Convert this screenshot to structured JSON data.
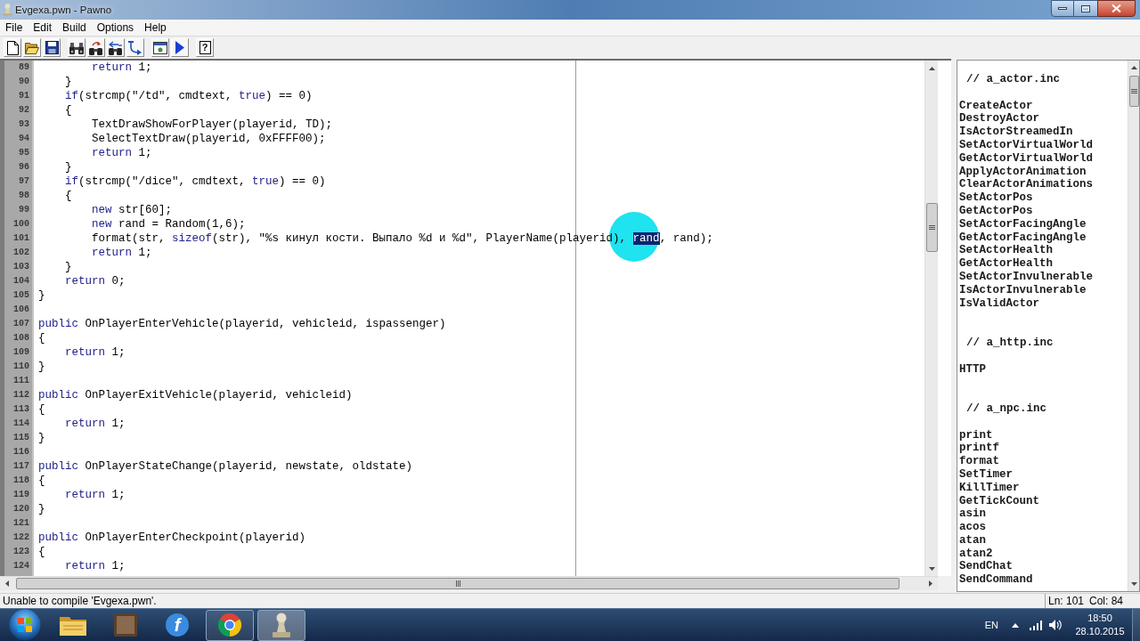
{
  "window": {
    "title": "Evgexa.pwn - Pawno"
  },
  "menu": [
    "File",
    "Edit",
    "Build",
    "Options",
    "Help"
  ],
  "toolbar": [
    [
      {
        "kind": "new"
      },
      {
        "kind": "open"
      },
      {
        "kind": "save"
      }
    ],
    [
      {
        "kind": "find"
      },
      {
        "kind": "find_next"
      },
      {
        "kind": "replace"
      },
      {
        "kind": "goto"
      }
    ],
    [
      {
        "kind": "compile"
      },
      {
        "kind": "run"
      }
    ],
    [
      {
        "kind": "help",
        "glyph": "?"
      }
    ]
  ],
  "editor": {
    "lines": [
      {
        "number": "89",
        "segments": [
          {
            "kind": "keyword",
            "text": "        return"
          },
          {
            "kind": "plain",
            "text": " 1;"
          }
        ]
      },
      {
        "number": "90",
        "segments": [
          {
            "kind": "plain",
            "text": "    }"
          }
        ]
      },
      {
        "number": "91",
        "segments": [
          {
            "kind": "keyword",
            "text": "    if"
          },
          {
            "kind": "plain",
            "text": "(strcmp(\"/td\", cmdtext, "
          },
          {
            "kind": "keyword",
            "text": "true"
          },
          {
            "kind": "plain",
            "text": ") == 0)"
          }
        ]
      },
      {
        "number": "92",
        "segments": [
          {
            "kind": "plain",
            "text": "    {"
          }
        ]
      },
      {
        "number": "93",
        "segments": [
          {
            "kind": "plain",
            "text": "        TextDrawShowForPlayer(playerid, TD);"
          }
        ]
      },
      {
        "number": "94",
        "segments": [
          {
            "kind": "plain",
            "text": "        SelectTextDraw(playerid, 0xFFFF00);"
          }
        ]
      },
      {
        "number": "95",
        "segments": [
          {
            "kind": "keyword",
            "text": "        return"
          },
          {
            "kind": "plain",
            "text": " 1;"
          }
        ]
      },
      {
        "number": "96",
        "segments": [
          {
            "kind": "plain",
            "text": "    }"
          }
        ]
      },
      {
        "number": "97",
        "segments": [
          {
            "kind": "keyword",
            "text": "    if"
          },
          {
            "kind": "plain",
            "text": "(strcmp(\"/dice\", cmdtext, "
          },
          {
            "kind": "keyword",
            "text": "true"
          },
          {
            "kind": "plain",
            "text": ") == 0)"
          }
        ]
      },
      {
        "number": "98",
        "segments": [
          {
            "kind": "plain",
            "text": "    {"
          }
        ]
      },
      {
        "number": "99",
        "segments": [
          {
            "kind": "keyword",
            "text": "        new"
          },
          {
            "kind": "plain",
            "text": " str[60];"
          }
        ]
      },
      {
        "number": "100",
        "segments": [
          {
            "kind": "keyword",
            "text": "        new"
          },
          {
            "kind": "plain",
            "text": " rand = Random(1,6);"
          }
        ]
      },
      {
        "number": "101",
        "segments": [
          {
            "kind": "plain",
            "text": "        format(str, "
          },
          {
            "kind": "keyword",
            "text": "sizeof"
          },
          {
            "kind": "plain",
            "text": "(str), \"%s кинул кости. Выпало %d и %d\", PlayerName(playerid), "
          },
          {
            "kind": "selected",
            "text": "rand"
          },
          {
            "kind": "plain",
            "text": ", rand);"
          }
        ]
      },
      {
        "number": "102",
        "segments": [
          {
            "kind": "keyword",
            "text": "        return"
          },
          {
            "kind": "plain",
            "text": " 1;"
          }
        ]
      },
      {
        "number": "103",
        "segments": [
          {
            "kind": "plain",
            "text": "    }"
          }
        ]
      },
      {
        "number": "104",
        "segments": [
          {
            "kind": "keyword",
            "text": "    return"
          },
          {
            "kind": "plain",
            "text": " 0;"
          }
        ]
      },
      {
        "number": "105",
        "segments": [
          {
            "kind": "plain",
            "text": "}"
          }
        ]
      },
      {
        "number": "106"
      },
      {
        "number": "107",
        "segments": [
          {
            "kind": "keyword",
            "text": "public"
          },
          {
            "kind": "plain",
            "text": " OnPlayerEnterVehicle(playerid, vehicleid, ispassenger)"
          }
        ]
      },
      {
        "number": "108",
        "segments": [
          {
            "kind": "plain",
            "text": "{"
          }
        ]
      },
      {
        "number": "109",
        "segments": [
          {
            "kind": "keyword",
            "text": "    return"
          },
          {
            "kind": "plain",
            "text": " 1;"
          }
        ]
      },
      {
        "number": "110",
        "segments": [
          {
            "kind": "plain",
            "text": "}"
          }
        ]
      },
      {
        "number": "111"
      },
      {
        "number": "112",
        "segments": [
          {
            "kind": "keyword",
            "text": "public"
          },
          {
            "kind": "plain",
            "text": " OnPlayerExitVehicle(playerid, vehicleid)"
          }
        ]
      },
      {
        "number": "113",
        "segments": [
          {
            "kind": "plain",
            "text": "{"
          }
        ]
      },
      {
        "number": "114",
        "segments": [
          {
            "kind": "keyword",
            "text": "    return"
          },
          {
            "kind": "plain",
            "text": " 1;"
          }
        ]
      },
      {
        "number": "115",
        "segments": [
          {
            "kind": "plain",
            "text": "}"
          }
        ]
      },
      {
        "number": "116"
      },
      {
        "number": "117",
        "segments": [
          {
            "kind": "keyword",
            "text": "public"
          },
          {
            "kind": "plain",
            "text": " OnPlayerStateChange(playerid, newstate, oldstate)"
          }
        ]
      },
      {
        "number": "118",
        "segments": [
          {
            "kind": "plain",
            "text": "{"
          }
        ]
      },
      {
        "number": "119",
        "segments": [
          {
            "kind": "keyword",
            "text": "    return"
          },
          {
            "kind": "plain",
            "text": " 1;"
          }
        ]
      },
      {
        "number": "120",
        "segments": [
          {
            "kind": "plain",
            "text": "}"
          }
        ]
      },
      {
        "number": "121"
      },
      {
        "number": "122",
        "segments": [
          {
            "kind": "keyword",
            "text": "public"
          },
          {
            "kind": "plain",
            "text": " OnPlayerEnterCheckpoint(playerid)"
          }
        ]
      },
      {
        "number": "123",
        "segments": [
          {
            "kind": "plain",
            "text": "{"
          }
        ]
      },
      {
        "number": "124",
        "segments": [
          {
            "kind": "keyword",
            "text": "    return"
          },
          {
            "kind": "plain",
            "text": " 1;"
          }
        ]
      }
    ]
  },
  "function_list": {
    "sections": [
      {
        "header": "// a_actor.inc",
        "items": [
          "CreateActor",
          "DestroyActor",
          "IsActorStreamedIn",
          "SetActorVirtualWorld",
          "GetActorVirtualWorld",
          "ApplyActorAnimation",
          "ClearActorAnimations",
          "SetActorPos",
          "GetActorPos",
          "SetActorFacingAngle",
          "GetActorFacingAngle",
          "SetActorHealth",
          "GetActorHealth",
          "SetActorInvulnerable",
          "IsActorInvulnerable",
          "IsValidActor"
        ]
      },
      {
        "header": "// a_http.inc",
        "items": [
          "HTTP"
        ]
      },
      {
        "header": "// a_npc.inc",
        "items": [
          "print",
          "printf",
          "format",
          "SetTimer",
          "KillTimer",
          "GetTickCount",
          "asin",
          "acos",
          "atan",
          "atan2",
          "SendChat",
          "SendCommand"
        ]
      }
    ]
  },
  "status_bar": {
    "message": "Unable to compile 'Evgexa.pwn'.",
    "line": "Ln: 101",
    "column": "Col: 84"
  },
  "taskbar": {
    "apps": [
      {
        "kind": "folder",
        "running": false,
        "selected": false
      },
      {
        "kind": "picture",
        "running": false,
        "selected": false
      },
      {
        "kind": "letter",
        "glyph": "f",
        "running": false,
        "selected": false
      },
      {
        "kind": "round-logo",
        "running": true,
        "selected": false
      },
      {
        "kind": "pawn",
        "running": true,
        "selected": true
      }
    ],
    "language": "EN",
    "time": "18:50",
    "date": "28.10.2015"
  }
}
